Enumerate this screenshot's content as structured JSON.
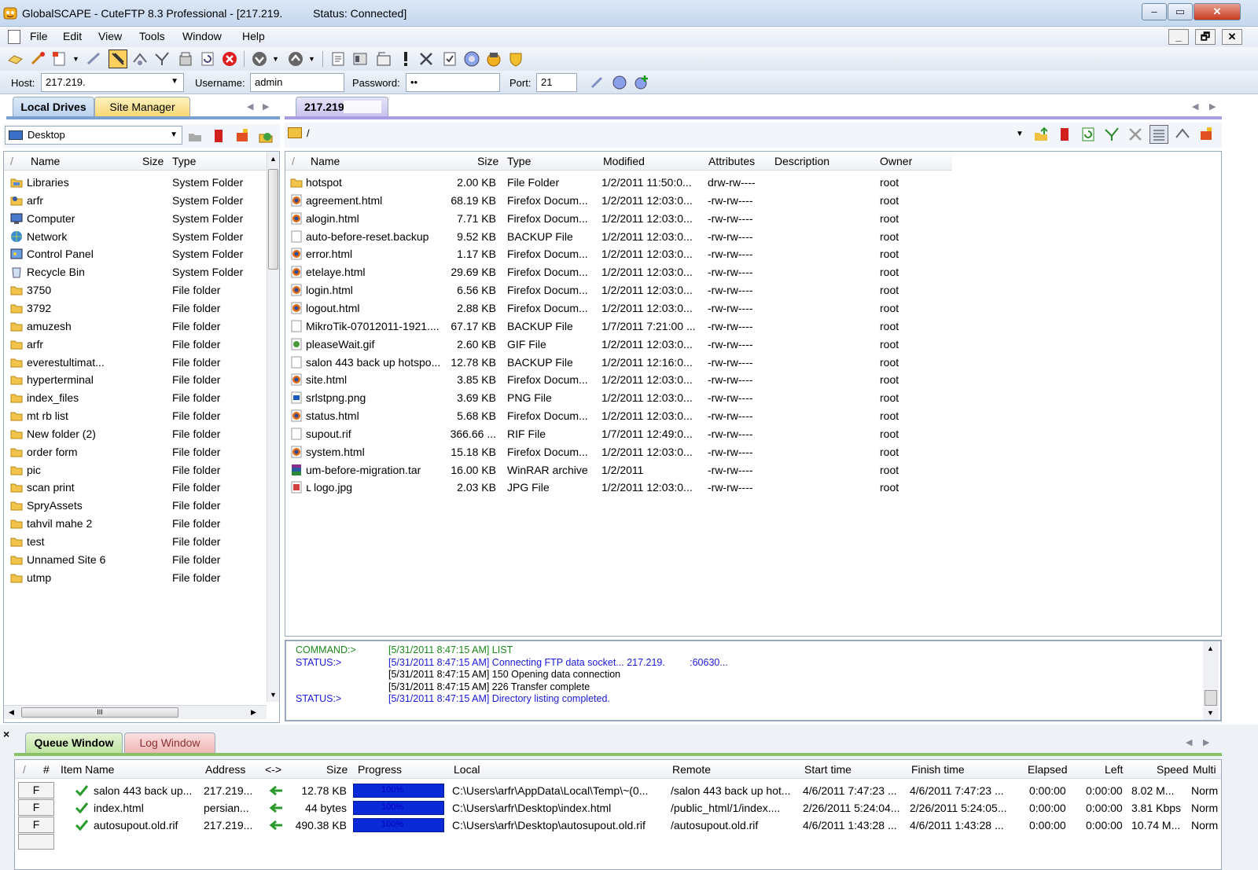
{
  "window": {
    "title": "GlobalSCAPE - CuteFTP 8.3 Professional - [217.219.          Status: Connected]",
    "min": "–",
    "max": "▭",
    "close": "✕"
  },
  "menu": {
    "items": [
      "File",
      "Edit",
      "View",
      "Tools",
      "Window",
      "Help"
    ],
    "mdi": [
      "_",
      "🗗",
      "✕"
    ]
  },
  "conn": {
    "host_label": "Host:",
    "host": "217.219.",
    "user_label": "Username:",
    "user": "admin",
    "pass_label": "Password:",
    "pass": "••",
    "port_label": "Port:",
    "port": "21"
  },
  "left": {
    "tabs": [
      "Local Drives",
      "Site Manager"
    ],
    "location": "Desktop",
    "headers": {
      "sort": "/",
      "name": "Name",
      "size": "Size",
      "type": "Type"
    },
    "items": [
      {
        "name": "Libraries",
        "type": "System Folder",
        "icon": "libraries-icon"
      },
      {
        "name": "arfr",
        "type": "System Folder",
        "icon": "user-folder-icon"
      },
      {
        "name": "Computer",
        "type": "System Folder",
        "icon": "computer-icon"
      },
      {
        "name": "Network",
        "type": "System Folder",
        "icon": "network-icon"
      },
      {
        "name": "Control Panel",
        "type": "System Folder",
        "icon": "control-panel-icon"
      },
      {
        "name": "Recycle Bin",
        "type": "System Folder",
        "icon": "recycle-bin-icon"
      },
      {
        "name": "3750",
        "type": "File folder",
        "icon": "folder-icon"
      },
      {
        "name": "3792",
        "type": "File folder",
        "icon": "folder-icon"
      },
      {
        "name": "amuzesh",
        "type": "File folder",
        "icon": "folder-icon"
      },
      {
        "name": "arfr",
        "type": "File folder",
        "icon": "folder-icon"
      },
      {
        "name": "everestultimat...",
        "type": "File folder",
        "icon": "folder-icon"
      },
      {
        "name": "hyperterminal",
        "type": "File folder",
        "icon": "folder-icon"
      },
      {
        "name": "index_files",
        "type": "File folder",
        "icon": "folder-icon"
      },
      {
        "name": "mt rb list",
        "type": "File folder",
        "icon": "folder-icon"
      },
      {
        "name": "New folder (2)",
        "type": "File folder",
        "icon": "folder-icon"
      },
      {
        "name": "order form",
        "type": "File folder",
        "icon": "folder-icon"
      },
      {
        "name": "pic",
        "type": "File folder",
        "icon": "folder-icon"
      },
      {
        "name": "scan print",
        "type": "File folder",
        "icon": "folder-icon"
      },
      {
        "name": "SpryAssets",
        "type": "File folder",
        "icon": "folder-icon"
      },
      {
        "name": "tahvil mahe 2",
        "type": "File folder",
        "icon": "folder-icon"
      },
      {
        "name": "test",
        "type": "File folder",
        "icon": "folder-icon"
      },
      {
        "name": "Unnamed Site 6",
        "type": "File folder",
        "icon": "folder-icon"
      },
      {
        "name": "utmp",
        "type": "File folder",
        "icon": "folder-icon"
      }
    ],
    "hscroll_label": "III"
  },
  "right": {
    "tab": "217.219",
    "path": "/",
    "headers": {
      "sort": "/",
      "name": "Name",
      "size": "Size",
      "type": "Type",
      "modified": "Modified",
      "attributes": "Attributes",
      "description": "Description",
      "owner": "Owner"
    },
    "files": [
      {
        "name": "hotspot",
        "size": "2.00 KB",
        "type": "File Folder",
        "modified": "1/2/2011 11:50:0...",
        "attr": "drw-rw----",
        "owner": "root",
        "icon": "folder-icon"
      },
      {
        "name": "agreement.html",
        "size": "68.19 KB",
        "type": "Firefox Docum...",
        "modified": "1/2/2011 12:03:0...",
        "attr": "-rw-rw----",
        "owner": "root",
        "icon": "firefox-doc-icon"
      },
      {
        "name": "alogin.html",
        "size": "7.71 KB",
        "type": "Firefox Docum...",
        "modified": "1/2/2011 12:03:0...",
        "attr": "-rw-rw----",
        "owner": "root",
        "icon": "firefox-doc-icon"
      },
      {
        "name": "auto-before-reset.backup",
        "size": "9.52 KB",
        "type": "BACKUP File",
        "modified": "1/2/2011 12:03:0...",
        "attr": "-rw-rw----",
        "owner": "root",
        "icon": "blank-file-icon"
      },
      {
        "name": "error.html",
        "size": "1.17 KB",
        "type": "Firefox Docum...",
        "modified": "1/2/2011 12:03:0...",
        "attr": "-rw-rw----",
        "owner": "root",
        "icon": "firefox-doc-icon"
      },
      {
        "name": "etelaye.html",
        "size": "29.69 KB",
        "type": "Firefox Docum...",
        "modified": "1/2/2011 12:03:0...",
        "attr": "-rw-rw----",
        "owner": "root",
        "icon": "firefox-doc-icon"
      },
      {
        "name": "login.html",
        "size": "6.56 KB",
        "type": "Firefox Docum...",
        "modified": "1/2/2011 12:03:0...",
        "attr": "-rw-rw----",
        "owner": "root",
        "icon": "firefox-doc-icon"
      },
      {
        "name": "logout.html",
        "size": "2.88 KB",
        "type": "Firefox Docum...",
        "modified": "1/2/2011 12:03:0...",
        "attr": "-rw-rw----",
        "owner": "root",
        "icon": "firefox-doc-icon"
      },
      {
        "name": "MikroTik-07012011-1921....",
        "size": "67.17 KB",
        "type": "BACKUP File",
        "modified": "1/7/2011 7:21:00 ...",
        "attr": "-rw-rw----",
        "owner": "root",
        "icon": "blank-file-icon"
      },
      {
        "name": "pleaseWait.gif",
        "size": "2.60 KB",
        "type": "GIF File",
        "modified": "1/2/2011 12:03:0...",
        "attr": "-rw-rw----",
        "owner": "root",
        "icon": "image-file-icon"
      },
      {
        "name": "salon 443 back up hotspo...",
        "size": "12.78 KB",
        "type": "BACKUP File",
        "modified": "1/2/2011 12:16:0...",
        "attr": "-rw-rw----",
        "owner": "root",
        "icon": "blank-file-icon"
      },
      {
        "name": "site.html",
        "size": "3.85 KB",
        "type": "Firefox Docum...",
        "modified": "1/2/2011 12:03:0...",
        "attr": "-rw-rw----",
        "owner": "root",
        "icon": "firefox-doc-icon"
      },
      {
        "name": "srlstpng.png",
        "size": "3.69 KB",
        "type": "PNG File",
        "modified": "1/2/2011 12:03:0...",
        "attr": "-rw-rw----",
        "owner": "root",
        "icon": "png-file-icon"
      },
      {
        "name": "status.html",
        "size": "5.68 KB",
        "type": "Firefox Docum...",
        "modified": "1/2/2011 12:03:0...",
        "attr": "-rw-rw----",
        "owner": "root",
        "icon": "firefox-doc-icon"
      },
      {
        "name": "supout.rif",
        "size": "366.66 ...",
        "type": "RIF File",
        "modified": "1/7/2011 12:49:0...",
        "attr": "-rw-rw----",
        "owner": "root",
        "icon": "blank-file-icon"
      },
      {
        "name": "system.html",
        "size": "15.18 KB",
        "type": "Firefox Docum...",
        "modified": "1/2/2011 12:03:0...",
        "attr": "-rw-rw----",
        "owner": "root",
        "icon": "firefox-doc-icon"
      },
      {
        "name": "um-before-migration.tar",
        "size": "16.00 KB",
        "type": "WinRAR archive",
        "modified": "1/2/2011",
        "attr": "-rw-rw----",
        "owner": "root",
        "icon": "winrar-icon"
      },
      {
        "name": "ւ   logo.jpg",
        "size": "2.03 KB",
        "type": "JPG File",
        "modified": "1/2/2011 12:03:0...",
        "attr": "-rw-rw----",
        "owner": "root",
        "icon": "jpg-file-icon"
      }
    ]
  },
  "log": [
    {
      "label": "COMMAND:>",
      "text": "[5/31/2011 8:47:15 AM] LIST",
      "color": "#1a8a1a"
    },
    {
      "label": "STATUS:>",
      "text": "[5/31/2011 8:47:15 AM] Connecting FTP data socket... 217.219.         :60630...",
      "color": "#1a1ad8"
    },
    {
      "label": "",
      "text": "[5/31/2011 8:47:15 AM] 150 Opening data connection",
      "color": "#000000"
    },
    {
      "label": "",
      "text": "[5/31/2011 8:47:15 AM] 226 Transfer complete",
      "color": "#000000"
    },
    {
      "label": "STATUS:>",
      "text": "[5/31/2011 8:47:15 AM] Directory listing completed.",
      "color": "#1a1ad8"
    }
  ],
  "bottom": {
    "close": "×",
    "tabs": [
      "Queue Window",
      "Log Window"
    ],
    "headers": {
      "sort": "/",
      "num": "#",
      "item": "Item Name",
      "address": "Address",
      "dir": "<->",
      "size": "Size",
      "progress": "Progress",
      "local": "Local",
      "remote": "Remote",
      "start": "Start time",
      "finish": "Finish time",
      "elapsed": "Elapsed",
      "left": "Left",
      "speed": "Speed",
      "multi": "Multi"
    },
    "rows": [
      {
        "f": "F",
        "item": "salon 443 back up...",
        "address": "217.219...",
        "size": "12.78 KB",
        "progress": 1.0,
        "progress_text": "100%",
        "local": "C:\\Users\\arfr\\AppData\\Local\\Temp\\~(0...",
        "remote": "/salon 443 back up hot...",
        "start": "4/6/2011 7:47:23 ...",
        "finish": "4/6/2011 7:47:23 ...",
        "elapsed": "0:00:00",
        "left": "0:00:00",
        "speed": "8.02 M...",
        "multi": "Norm"
      },
      {
        "f": "F",
        "item": "index.html",
        "address": "persian...",
        "size": "44 bytes",
        "progress": 1.0,
        "progress_text": "100%",
        "local": "C:\\Users\\arfr\\Desktop\\index.html",
        "remote": "/public_html/1/index....",
        "start": "2/26/2011 5:24:04...",
        "finish": "2/26/2011 5:24:05...",
        "elapsed": "0:00:00",
        "left": "0:00:00",
        "speed": "3.81 Kbps",
        "multi": "Norm"
      },
      {
        "f": "F",
        "item": "autosupout.old.rif",
        "address": "217.219...",
        "size": "490.38 KB",
        "progress": 1.0,
        "progress_text": "100%",
        "local": "C:\\Users\\arfr\\Desktop\\autosupout.old.rif",
        "remote": "/autosupout.old.rif",
        "start": "4/6/2011 1:43:28 ...",
        "finish": "4/6/2011 1:43:28 ...",
        "elapsed": "0:00:00",
        "left": "0:00:00",
        "speed": "10.74 M...",
        "multi": "Norm"
      }
    ]
  }
}
